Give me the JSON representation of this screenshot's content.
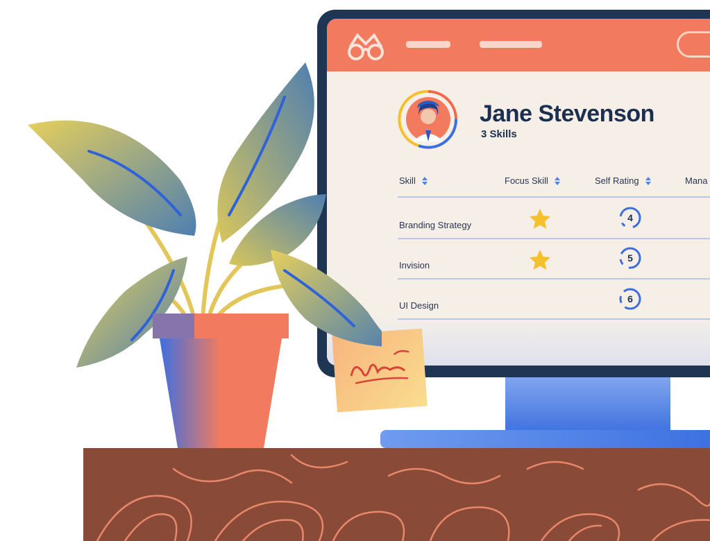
{
  "profile": {
    "name": "Jane Stevenson",
    "skill_count": "3 Skills"
  },
  "table": {
    "columns": [
      "Skill",
      "Focus Skill",
      "Self Rating",
      "Mana"
    ],
    "rows": [
      {
        "skill": "Branding Strategy",
        "focus": true,
        "self_rating": "4"
      },
      {
        "skill": "Invision",
        "focus": true,
        "self_rating": "5"
      },
      {
        "skill": "UI Design",
        "focus": false,
        "self_rating": "6"
      }
    ]
  },
  "icons": {
    "logo": "glasses-icon",
    "sort": "sort-arrows-icon",
    "focus": "star-icon",
    "avatar": "user-avatar-icon"
  },
  "colors": {
    "header": "#f27b5f",
    "screen": "#f5efe8",
    "frame": "#1f3554",
    "accent_blue": "#3c6ee0",
    "star": "#f5c02c",
    "desk": "#8a4a38"
  }
}
